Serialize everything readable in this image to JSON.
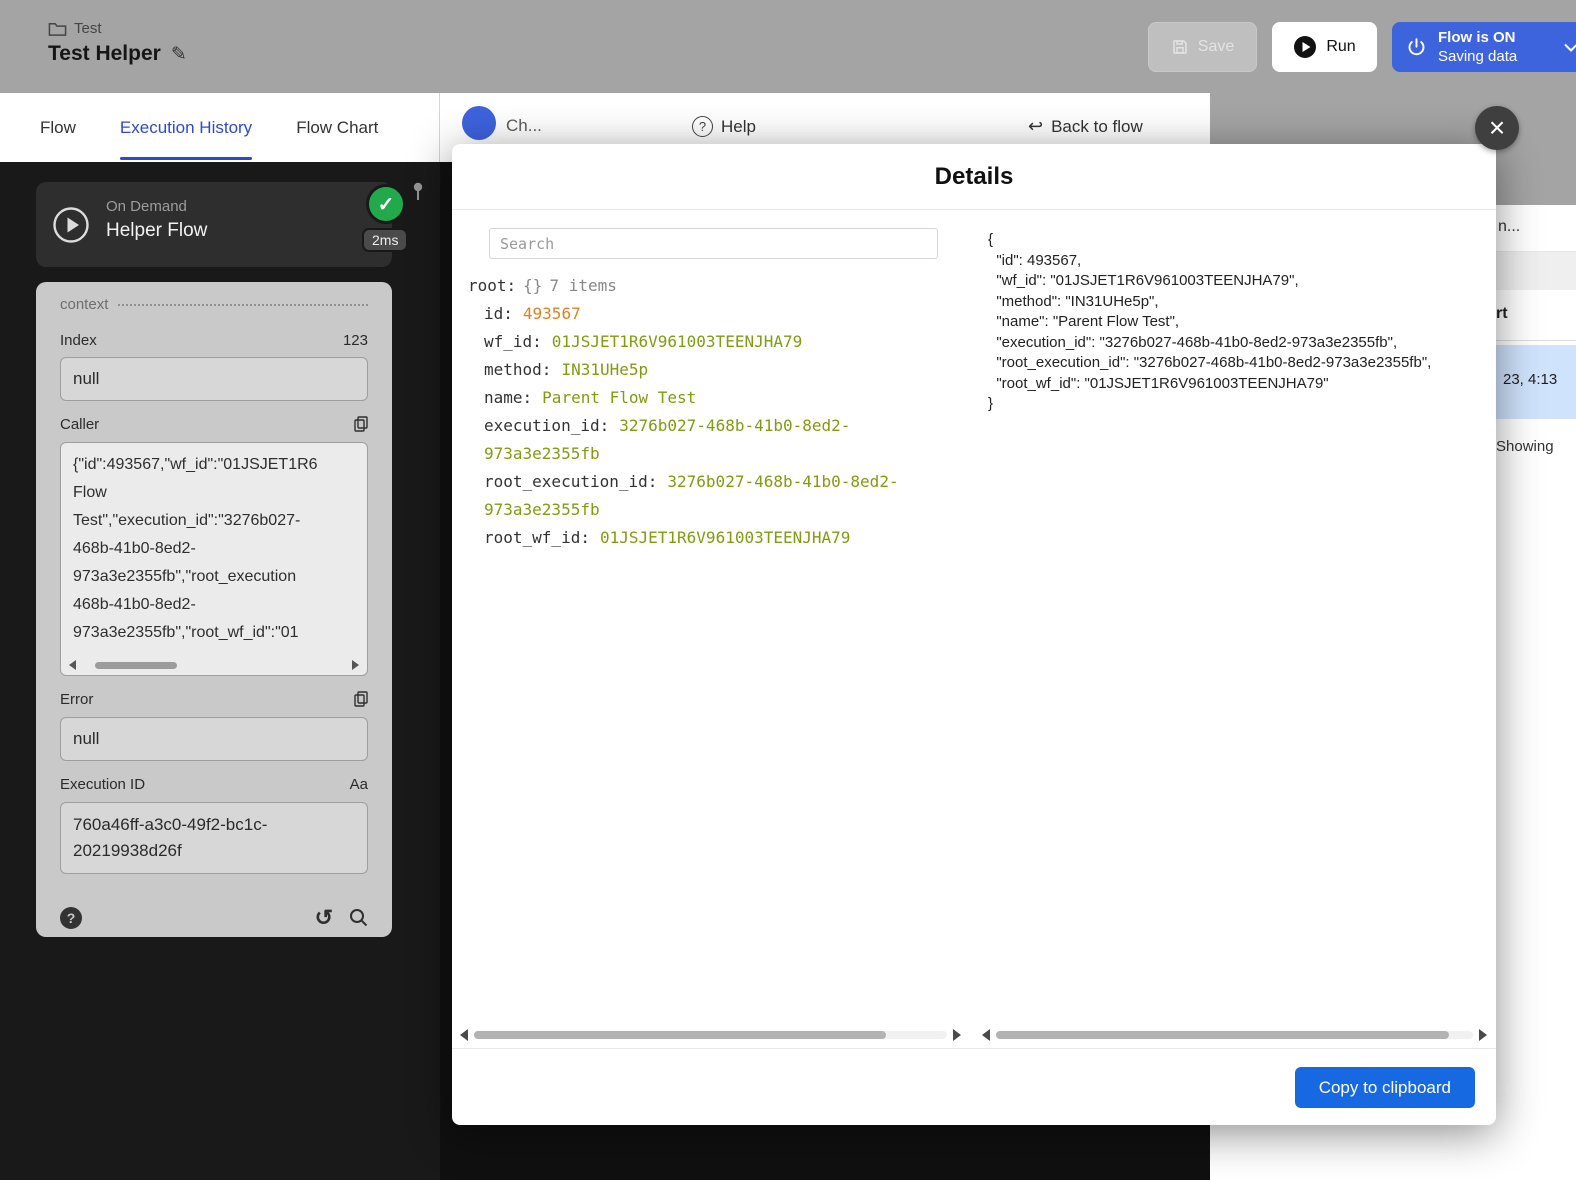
{
  "header": {
    "project_label": "Test",
    "flow_title": "Test Helper",
    "save_button": "Save",
    "run_button": "Run",
    "flow_toggle": {
      "line1": "Flow is ON",
      "line2": "Saving data"
    }
  },
  "tabs": {
    "flow": "Flow",
    "execution_history": "Execution History",
    "flow_chart": "Flow Chart"
  },
  "subheader": {
    "step_fragment": "Ch...",
    "help": "Help",
    "back_to_flow": "Back to flow"
  },
  "sidebar": {
    "node_card": {
      "type_label": "On Demand",
      "title": "Helper Flow",
      "duration_badge": "2ms"
    },
    "context_label": "context",
    "index": {
      "label": "Index",
      "hint": "123",
      "value": "null"
    },
    "caller": {
      "label": "Caller",
      "lines": [
        "{\"id\":493567,\"wf_id\":\"01JSJET1R6",
        "Flow",
        "Test\",\"execution_id\":\"3276b027-",
        "468b-41b0-8ed2-",
        "973a3e2355fb\",\"root_execution",
        "468b-41b0-8ed2-",
        "973a3e2355fb\",\"root_wf_id\":\"01"
      ]
    },
    "error": {
      "label": "Error",
      "value": "null"
    },
    "execution_id": {
      "label": "Execution ID",
      "hint": "Aa",
      "value": "760a46ff-a3c0-49f2-bc1c-20219938d26f"
    }
  },
  "modal": {
    "title": "Details",
    "search_placeholder": "Search",
    "tree": {
      "root_key": "root:",
      "root_braces": "{}",
      "root_meta": "7 items",
      "items": [
        {
          "key": "id:",
          "value": "493567",
          "type": "number"
        },
        {
          "key": "wf_id:",
          "value": "01JSJET1R6V961003TEENJHA79",
          "type": "string"
        },
        {
          "key": "method:",
          "value": "IN31UHe5p",
          "type": "string"
        },
        {
          "key": "name:",
          "value": "Parent Flow Test",
          "type": "string"
        },
        {
          "key": "execution_id:",
          "value": "3276b027-468b-41b0-8ed2-973a3e2355fb",
          "type": "string"
        },
        {
          "key": "root_execution_id:",
          "value": "3276b027-468b-41b0-8ed2-973a3e2355fb",
          "type": "string"
        },
        {
          "key": "root_wf_id:",
          "value": "01JSJET1R6V961003TEENJHA79",
          "type": "string"
        }
      ]
    },
    "raw_json_lines": [
      "{",
      "  \"id\": 493567,",
      "  \"wf_id\": \"01JSJET1R6V961003TEENJHA79\",",
      "  \"method\": \"IN31UHe5p\",",
      "  \"name\": \"Parent Flow Test\",",
      "  \"execution_id\": \"3276b027-468b-41b0-8ed2-973a3e2355fb\",",
      "  \"root_execution_id\": \"3276b027-468b-41b0-8ed2-973a3e2355fb\",",
      "  \"root_wf_id\": \"01JSJET1R6V961003TEENJHA79\"",
      "}"
    ],
    "copy_button": "Copy to clipboard"
  },
  "right_panel": {
    "fragment_top": "n...",
    "fragment_header": "rt",
    "selected_row_fragment": "23, 4:13",
    "footer_fragment": "Showing"
  },
  "icons": {
    "edit": "✎",
    "close": "×",
    "back_arrow": "↩",
    "history": "↺",
    "check": "✓",
    "help": "?",
    "context_help": "?"
  },
  "colors": {
    "header_gray": "#a4a4a4",
    "accent_blue": "#2b4ad4",
    "flow_on_blue": "#3d63dd",
    "primary_button_blue": "#1669e1",
    "success_green": "#21a94c",
    "json_number": "#e0821f",
    "json_string": "#7f9d0e",
    "selected_row_blue": "#cfe3fd"
  }
}
